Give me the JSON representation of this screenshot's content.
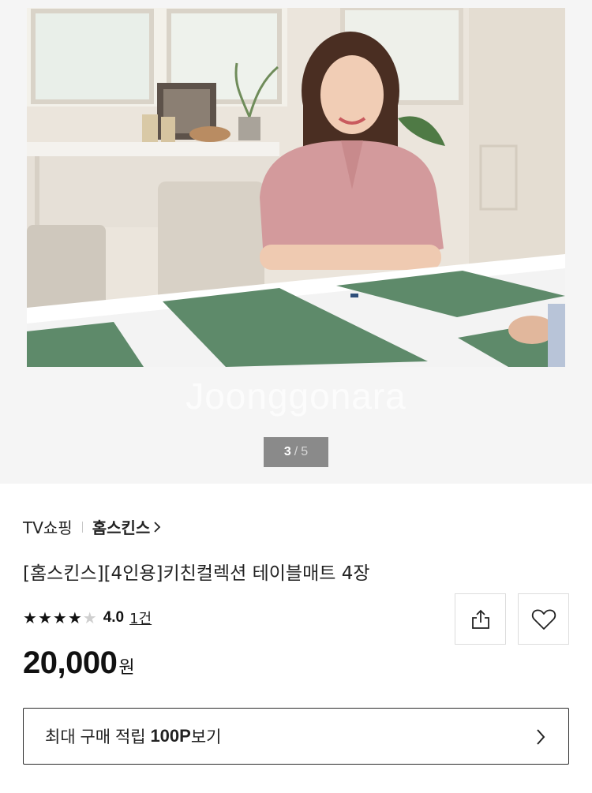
{
  "gallery": {
    "watermark": "Joonggonara",
    "current": "3",
    "separator": "/",
    "total": "5",
    "image_alt": "녹색 테이블매트가 놓인 식탁에 앉은 여성"
  },
  "product": {
    "channel": "TV쇼핑",
    "brand": "홈스킨스",
    "title": "[홈스킨스][4인용]키친컬렉션 테이블매트 4장",
    "rating_value": 4,
    "rating_max": 5,
    "rating_text": "4.0",
    "review_count": "1건",
    "price": "20,000",
    "price_unit": "원"
  },
  "points": {
    "prefix": "최대 구매 적립 ",
    "amount": "100P",
    "suffix": "보기"
  },
  "icons": {
    "share": "share-icon",
    "wish": "heart-icon",
    "brand_link": "chevron-right-icon",
    "points_link": "chevron-right-icon"
  },
  "colors": {
    "placemat": "#5e8a6a",
    "blouse": "#d39a9c",
    "pager_bg": "#8a8a8a"
  }
}
